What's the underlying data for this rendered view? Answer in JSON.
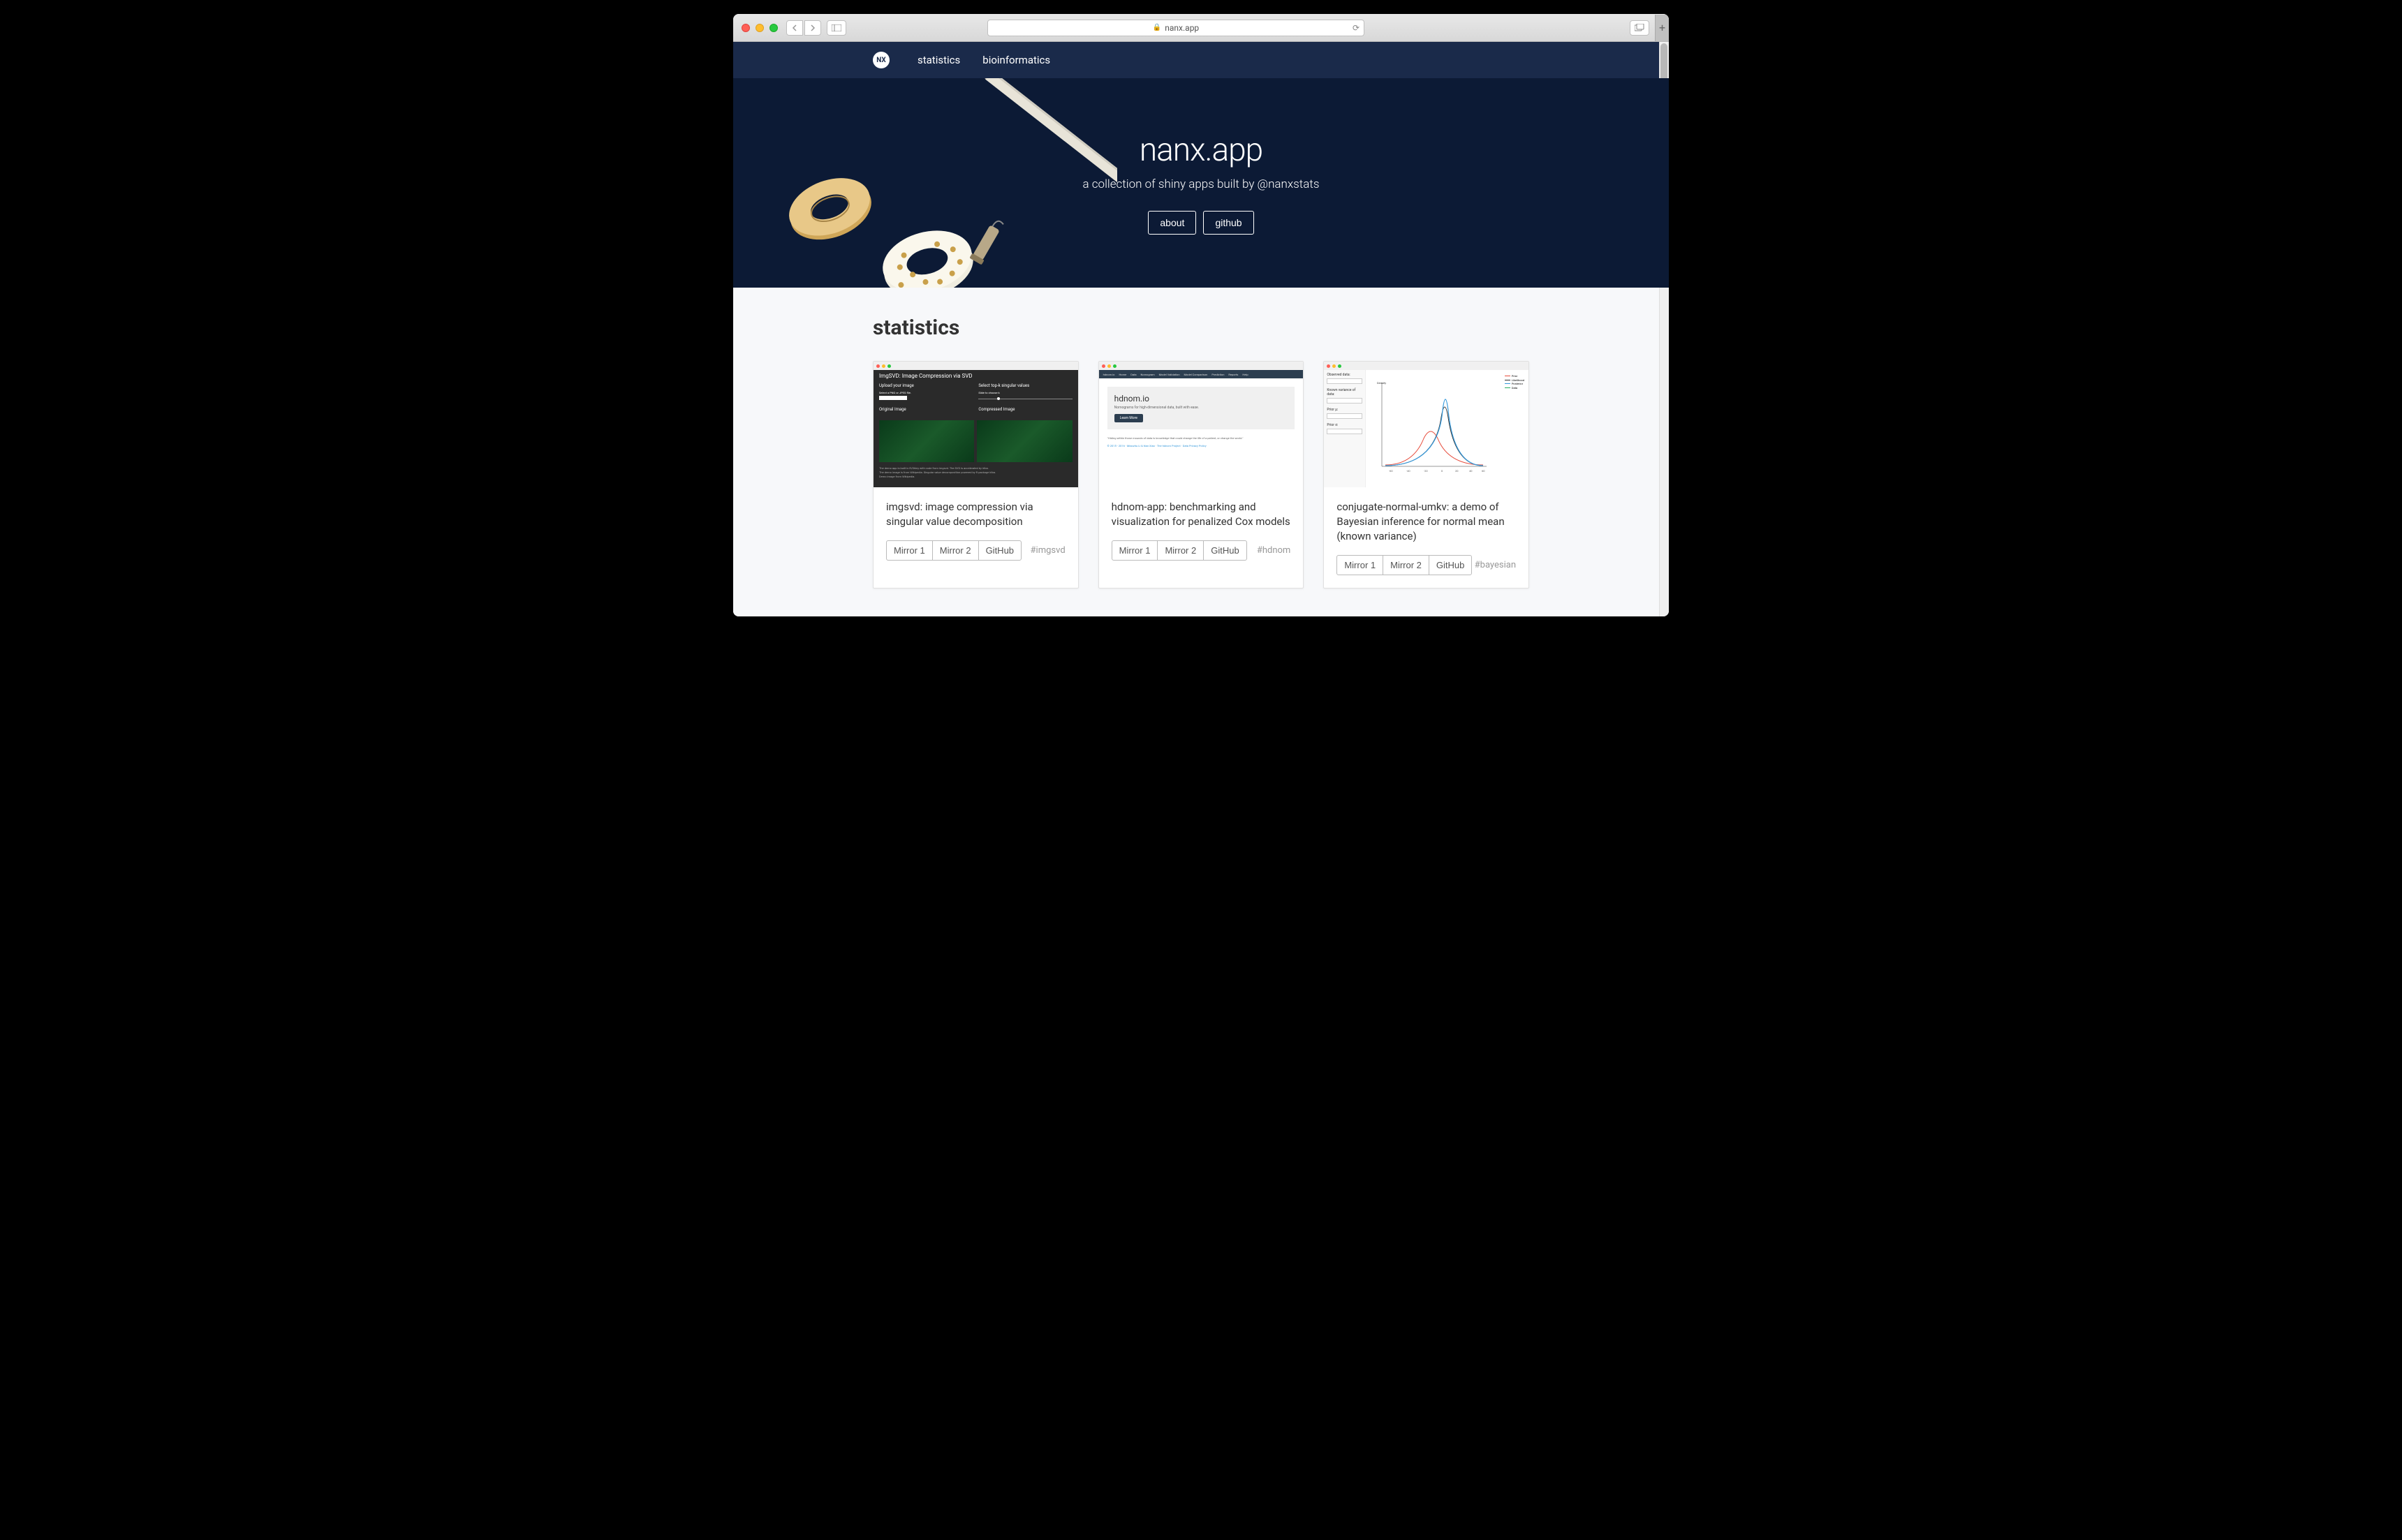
{
  "browser": {
    "url": "nanx.app"
  },
  "navbar": {
    "logo": "NX",
    "links": [
      "statistics",
      "bioinformatics"
    ]
  },
  "hero": {
    "title": "nanx.app",
    "subtitle": "a collection of shiny apps built by @nanxstats",
    "buttons": [
      "about",
      "github"
    ]
  },
  "section": {
    "title": "statistics"
  },
  "cards": [
    {
      "title": "imgsvd: image compression via singular value decomposition",
      "buttons": [
        "Mirror 1",
        "Mirror 2",
        "GitHub"
      ],
      "tag": "#imgsvd",
      "preview": {
        "title": "ImgSVD: Image Compression via SVD",
        "left_label": "Upload your image",
        "left_hint": "Select a PNG or JPEG file.",
        "right_label": "Select top-k singular values",
        "right_hint": "Slide to choose k",
        "img1": "Original Image",
        "img2": "Compressed Image"
      }
    },
    {
      "title": "hdnom-app: benchmarking and visualization for penalized Cox models",
      "buttons": [
        "Mirror 1",
        "Mirror 2",
        "GitHub"
      ],
      "tag": "#hdnom",
      "preview": {
        "nav": [
          "hdnom.io",
          "Home",
          "Data",
          "Nomogram",
          "Model Validation",
          "Model Comparison",
          "Prediction",
          "Reports",
          "Help"
        ],
        "title": "hdnom.io",
        "subtitle": "Nomograms for high-dimensional data, built with ease.",
        "button": "Learn More",
        "quote": "\"Hiding within those mounds of data is knowledge that could change the life of a patient, or change the world.\"",
        "links": "© 2015 - 2016 · Miaozhu Li & Nan Xiao · The hdnom Project · Data Privacy Policy"
      }
    },
    {
      "title": "conjugate-normal-umkv: a demo of Bayesian inference for normal mean (known variance)",
      "buttons": [
        "Mirror 1",
        "Mirror 2",
        "GitHub"
      ],
      "tag": "#bayesian",
      "preview": {
        "fields": [
          "Observed data:",
          "Known variance of data:",
          "Prior µ:",
          "Prior σ:"
        ],
        "legend": [
          "Prior",
          "Likelihood",
          "Posterior",
          "Data"
        ]
      }
    }
  ]
}
